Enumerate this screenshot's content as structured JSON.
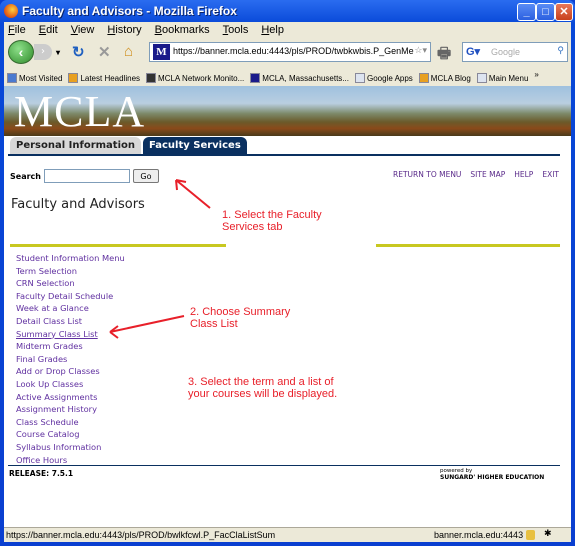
{
  "window": {
    "title": "Faculty and Advisors - Mozilla Firefox"
  },
  "menu": [
    "File",
    "Edit",
    "View",
    "History",
    "Bookmarks",
    "Tools",
    "Help"
  ],
  "nav": {
    "url": "https://banner.mcla.edu:4443/pls/PROD/twbkwbis.P_GenMe",
    "search_placeholder": "Google"
  },
  "bookmarks": [
    {
      "label": "Most Visited",
      "icon": "folder-icon"
    },
    {
      "label": "Latest Headlines",
      "icon": "rss-icon"
    },
    {
      "label": "MCLA Network Monito...",
      "icon": "linux-penguin-icon"
    },
    {
      "label": "MCLA, Massachusetts...",
      "icon": "mcla-favicon"
    },
    {
      "label": "Google Apps",
      "icon": "page-icon"
    },
    {
      "label": "MCLA Blog",
      "icon": "rss-icon"
    },
    {
      "label": "Main Menu",
      "icon": "page-icon"
    }
  ],
  "page": {
    "logo": "MCLA",
    "tabs": [
      {
        "label": "Personal Information",
        "active": false
      },
      {
        "label": "Faculty Services",
        "active": true
      }
    ],
    "search_label": "Search",
    "go_label": "Go",
    "toplinks": [
      "RETURN TO MENU",
      "SITE MAP",
      "HELP",
      "EXIT"
    ],
    "heading": "Faculty and Advisors",
    "links": [
      "Student Information Menu",
      "Term Selection",
      "CRN Selection",
      "Faculty Detail Schedule",
      "Week at a Glance",
      "Detail Class List",
      "Summary Class List",
      "Midterm Grades",
      "Final Grades",
      "Add or Drop Classes",
      "Look Up Classes",
      "Active Assignments",
      "Assignment History",
      "Class Schedule",
      "Course Catalog",
      "Syllabus Information",
      "Office Hours"
    ],
    "release": "RELEASE: 7.5.1",
    "powered_by": "powered by",
    "sungard": "SUNGARD' HIGHER EDUCATION"
  },
  "annotations": [
    "1. Select the Faculty Services tab",
    "2. Choose Summary Class List",
    "3. Select the term and a list of your courses will be displayed."
  ],
  "status": {
    "url": "https://banner.mcla.edu:4443/pls/PROD/bwlkfcwl.P_FacClaListSum",
    "host": "banner.mcla.edu:4443"
  },
  "colors": {
    "link": "#6030a0",
    "tab_active": "#0a3060",
    "accent_line": "#c8c820",
    "annotation": "#e8202a"
  }
}
